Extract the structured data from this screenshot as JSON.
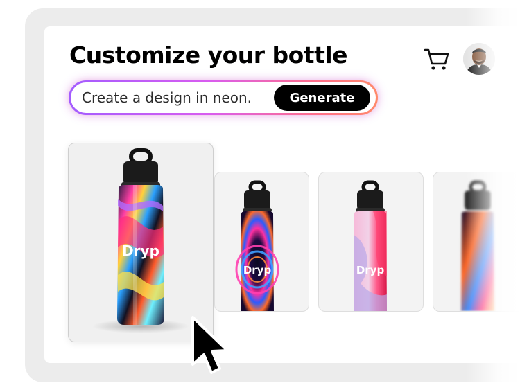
{
  "header": {
    "title": "Customize your bottle",
    "cart_icon": "cart-icon",
    "avatar": "user-avatar"
  },
  "prompt": {
    "value": "Create a design in neon.",
    "button_label": "Generate",
    "ring_colors": [
      "#a35cff",
      "#d85cf0",
      "#ff6f8a",
      "#ff8a6a"
    ]
  },
  "gallery": {
    "brand_label": "Dryp",
    "items": [
      {
        "design": "marbled-rainbow",
        "selected": true
      },
      {
        "design": "neon-rings",
        "selected": false
      },
      {
        "design": "pink-waves",
        "selected": false
      },
      {
        "design": "abstract-flame",
        "selected": false
      }
    ]
  },
  "pointer": "cursor-arrow-icon",
  "colors": {
    "text": "#000000",
    "button_bg": "#000000",
    "button_text": "#ffffff",
    "frame": "#ececec"
  }
}
